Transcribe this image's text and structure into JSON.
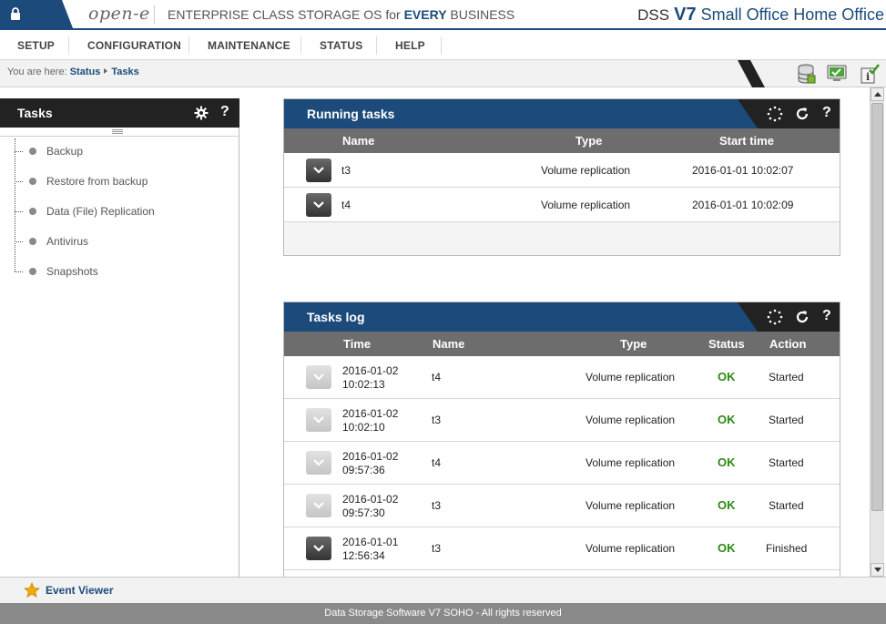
{
  "header": {
    "logo": "open-e",
    "tagline_prefix": "ENTERPRISE CLASS STORAGE OS for ",
    "tagline_bold": "EVERY",
    "tagline_suffix": " BUSINESS",
    "product_dss": "DSS",
    "product_version": "V7",
    "product_edition": "Small Office Home Office"
  },
  "menu": [
    "SETUP",
    "CONFIGURATION",
    "MAINTENANCE",
    "STATUS",
    "HELP"
  ],
  "breadcrumb": {
    "prefix": "You are here:",
    "items": [
      "Status",
      "Tasks"
    ]
  },
  "sidebar": {
    "title": "Tasks",
    "help": "?",
    "items": [
      "Backup",
      "Restore from backup",
      "Data (File) Replication",
      "Antivirus",
      "Snapshots"
    ]
  },
  "running_tasks": {
    "title": "Running tasks",
    "help": "?",
    "columns": [
      "Name",
      "Type",
      "Start time"
    ],
    "rows": [
      {
        "name": "t3",
        "type": "Volume replication",
        "start_time": "2016-01-01 10:02:07"
      },
      {
        "name": "t4",
        "type": "Volume replication",
        "start_time": "2016-01-01 10:02:09"
      }
    ]
  },
  "tasks_log": {
    "title": "Tasks log",
    "help": "?",
    "columns": [
      "Time",
      "Name",
      "Type",
      "Status",
      "Action"
    ],
    "rows": [
      {
        "date": "2016-01-02",
        "time": "10:02:13",
        "name": "t4",
        "type": "Volume replication",
        "status": "OK",
        "action": "Started"
      },
      {
        "date": "2016-01-02",
        "time": "10:02:10",
        "name": "t3",
        "type": "Volume replication",
        "status": "OK",
        "action": "Started"
      },
      {
        "date": "2016-01-02",
        "time": "09:57:36",
        "name": "t4",
        "type": "Volume replication",
        "status": "OK",
        "action": "Started"
      },
      {
        "date": "2016-01-02",
        "time": "09:57:30",
        "name": "t3",
        "type": "Volume replication",
        "status": "OK",
        "action": "Started"
      },
      {
        "date": "2016-01-01",
        "time": "12:56:34",
        "name": "t3",
        "type": "Volume replication",
        "status": "OK",
        "action": "Finished"
      }
    ]
  },
  "event_viewer": "Event Viewer",
  "footer": "Data Storage Software V7 SOHO - All rights reserved",
  "colors": {
    "accent": "#1c4a7a",
    "dark": "#222222",
    "ok": "#2d8a12"
  },
  "icons": [
    "lock-icon",
    "gear-icon",
    "loading-icon",
    "refresh-icon",
    "help-icon",
    "chevron-down-icon",
    "star-icon",
    "database-icon",
    "monitor-check-icon",
    "info-check-icon"
  ]
}
